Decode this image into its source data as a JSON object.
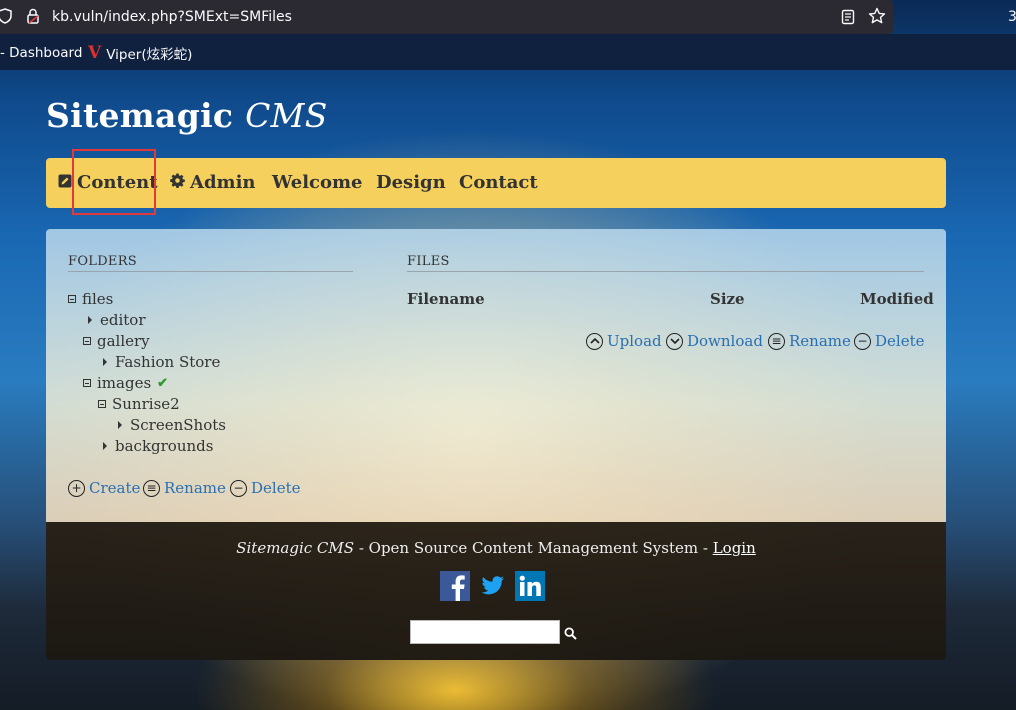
{
  "browser": {
    "url": "kb.vuln/index.php?SMExt=SMFiles",
    "bookmarks": [
      "- Dashboard",
      "Viper(炫彩蛇)"
    ],
    "edge_char": "3"
  },
  "site": {
    "title_main": "Sitemagic",
    "title_cms": "CMS"
  },
  "menu": {
    "items": [
      {
        "label": "Content",
        "icon": "edit-icon"
      },
      {
        "label": "Admin",
        "icon": "gear-icon"
      },
      {
        "label": "Welcome"
      },
      {
        "label": "Design"
      },
      {
        "label": "Contact"
      }
    ]
  },
  "folders": {
    "heading": "FOLDERS",
    "tree": [
      {
        "label": "files",
        "state": "expanded"
      },
      {
        "label": "editor",
        "state": "collapsed"
      },
      {
        "label": "gallery",
        "state": "expanded"
      },
      {
        "label": "Fashion Store",
        "state": "collapsed"
      },
      {
        "label": "images",
        "state": "expanded",
        "selected": true
      },
      {
        "label": "Sunrise2",
        "state": "expanded"
      },
      {
        "label": "ScreenShots",
        "state": "collapsed"
      },
      {
        "label": "backgrounds",
        "state": "collapsed"
      }
    ],
    "actions": [
      "Create",
      "Rename",
      "Delete"
    ]
  },
  "files": {
    "heading": "FILES",
    "columns": [
      "Filename",
      "Size",
      "Modified"
    ],
    "actions": [
      "Upload",
      "Download",
      "Rename",
      "Delete"
    ]
  },
  "footer": {
    "brand": "Sitemagic CMS",
    "text": " - Open Source Content Management System - ",
    "login": "Login",
    "search_value": ""
  },
  "colors": {
    "menu_bg": "#f5d05c",
    "link": "#2a6fb0",
    "highlight": "#e03a3a",
    "facebook": "#3b5998",
    "twitter": "#1da1f2",
    "linkedin": "#0077b5"
  }
}
